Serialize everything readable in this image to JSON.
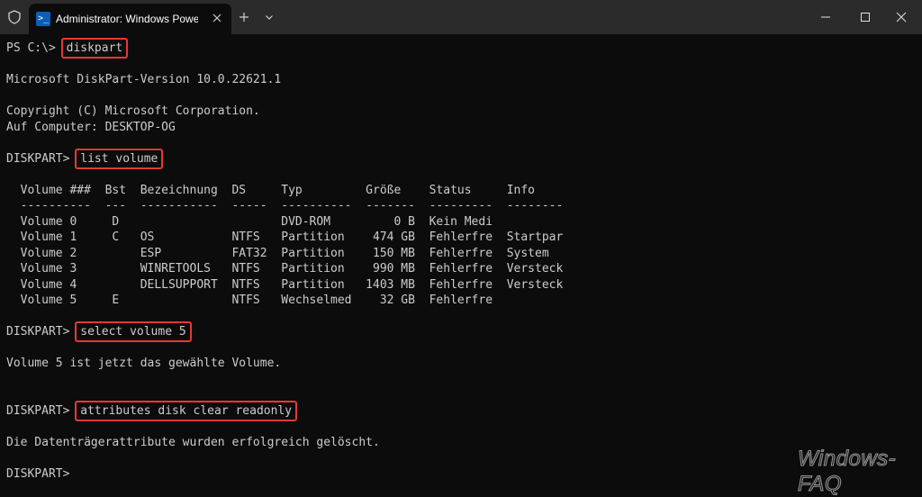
{
  "window": {
    "tab_title": "Administrator: Windows PowerShell",
    "tab_icon": "powershell-icon"
  },
  "colors": {
    "background": "#0c0c0c",
    "titlebar": "#2b2b2b",
    "text": "#cccccc",
    "highlight_box": "#e53935"
  },
  "terminal": {
    "lines": [
      {
        "prompt": "PS C:\\> ",
        "command": "diskpart"
      },
      {
        "text": ""
      },
      {
        "text": "Microsoft DiskPart-Version 10.0.22621.1"
      },
      {
        "text": ""
      },
      {
        "text": "Copyright (C) Microsoft Corporation."
      },
      {
        "text": "Auf Computer: DESKTOP-OG"
      },
      {
        "text": ""
      },
      {
        "prompt": "DISKPART> ",
        "command": "list volume"
      },
      {
        "text": ""
      },
      {
        "text": "  Volume ###  Bst  Bezeichnung  DS     Typ         Größe    Status     Info"
      },
      {
        "text": "  ----------  ---  -----------  -----  ----------  -------  ---------  --------"
      },
      {
        "text": "  Volume 0     D                       DVD-ROM         0 B  Kein Medi"
      },
      {
        "text": "  Volume 1     C   OS           NTFS   Partition    474 GB  Fehlerfre  Startpar"
      },
      {
        "text": "  Volume 2         ESP          FAT32  Partition    150 MB  Fehlerfre  System"
      },
      {
        "text": "  Volume 3         WINRETOOLS   NTFS   Partition    990 MB  Fehlerfre  Versteck"
      },
      {
        "text": "  Volume 4         DELLSUPPORT  NTFS   Partition   1403 MB  Fehlerfre  Versteck"
      },
      {
        "text": "  Volume 5     E                NTFS   Wechselmed    32 GB  Fehlerfre"
      },
      {
        "text": ""
      },
      {
        "prompt": "DISKPART> ",
        "command": "select volume 5"
      },
      {
        "text": ""
      },
      {
        "text": "Volume 5 ist jetzt das gewählte Volume."
      },
      {
        "text": ""
      },
      {
        "text": ""
      },
      {
        "prompt": "DISKPART> ",
        "command": "attributes disk clear readonly"
      },
      {
        "text": ""
      },
      {
        "text": "Die Datenträgerattribute wurden erfolgreich gelöscht."
      },
      {
        "text": ""
      },
      {
        "prompt": "DISKPART> ",
        "command": ""
      }
    ]
  },
  "watermark": "Windows-FAQ"
}
